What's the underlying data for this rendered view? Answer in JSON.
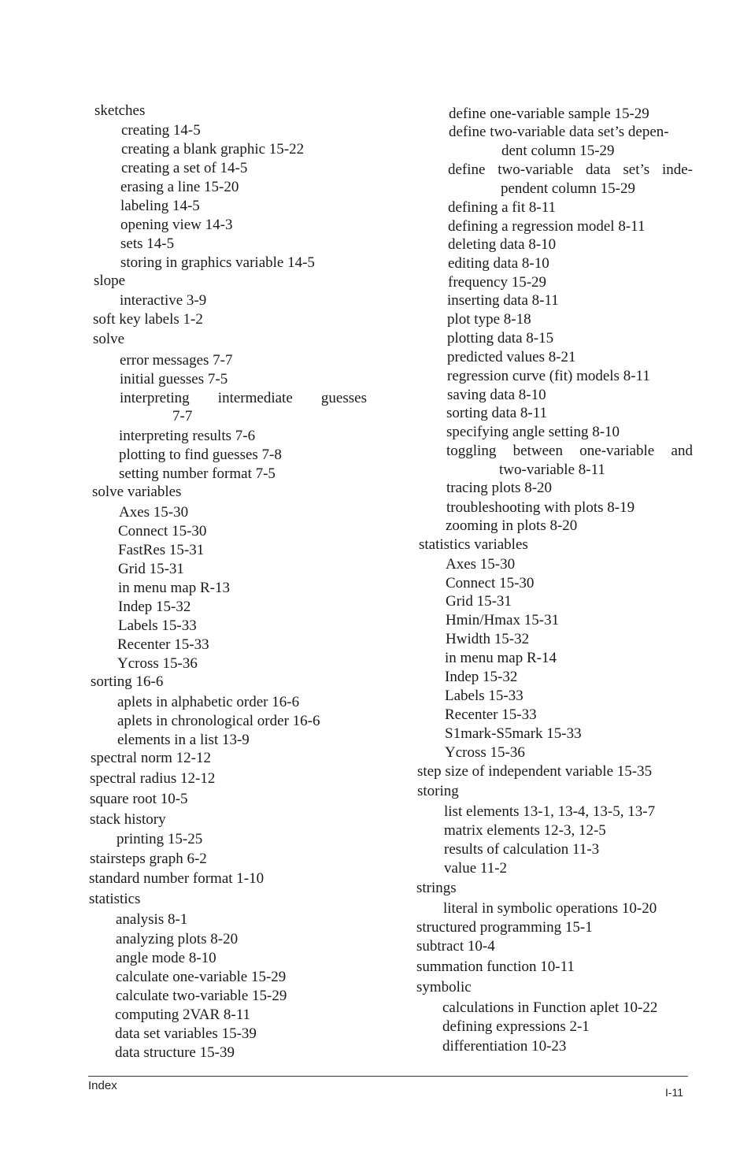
{
  "left_column": [
    {
      "text": "sketches",
      "level": 0
    },
    {
      "text": "creating 14-5",
      "level": 1
    },
    {
      "text": "creating a blank graphic 15-22",
      "level": 1
    },
    {
      "text": "creating a set of 14-5",
      "level": 1
    },
    {
      "text": "erasing a line 15-20",
      "level": 1
    },
    {
      "text": "labeling 14-5",
      "level": 1
    },
    {
      "text": "opening view 14-3",
      "level": 1
    },
    {
      "text": "sets 14-5",
      "level": 1
    },
    {
      "text": "storing in graphics variable 14-5",
      "level": 1
    },
    {
      "text": "slope",
      "level": 0
    },
    {
      "text": "interactive 3-9",
      "level": 1
    },
    {
      "text": "soft key labels 1-2",
      "level": 0
    },
    {
      "text": "solve",
      "level": 0
    },
    {
      "text": "error messages 7-7",
      "level": 1
    },
    {
      "text": "initial guesses 7-5",
      "level": 1
    },
    {
      "text": "interpreting intermediate guesses",
      "level": 1,
      "justify": true
    },
    {
      "text": "7-7",
      "level": 2
    },
    {
      "text": "interpreting results 7-6",
      "level": 1
    },
    {
      "text": "plotting to find guesses 7-8",
      "level": 1
    },
    {
      "text": "setting number format 7-5",
      "level": 1
    },
    {
      "text": "solve variables",
      "level": 0
    },
    {
      "text": "Axes 15-30",
      "level": 1
    },
    {
      "text": "Connect 15-30",
      "level": 1
    },
    {
      "text": "FastRes 15-31",
      "level": 1
    },
    {
      "text": "Grid 15-31",
      "level": 1
    },
    {
      "text": "in menu map R-13",
      "level": 1
    },
    {
      "text": "Indep 15-32",
      "level": 1
    },
    {
      "text": "Labels 15-33",
      "level": 1
    },
    {
      "text": "Recenter 15-33",
      "level": 1
    },
    {
      "text": "Ycross 15-36",
      "level": 1
    },
    {
      "text": "sorting 16-6",
      "level": 0
    },
    {
      "text": "aplets in alphabetic order 16-6",
      "level": 1
    },
    {
      "text": "aplets in chronological order 16-6",
      "level": 1
    },
    {
      "text": "elements in a list 13-9",
      "level": 1
    },
    {
      "text": "spectral norm 12-12",
      "level": 0
    },
    {
      "text": "spectral radius 12-12",
      "level": 0
    },
    {
      "text": "square root 10-5",
      "level": 0
    },
    {
      "text": "stack history",
      "level": 0
    },
    {
      "text": "printing 15-25",
      "level": 1
    },
    {
      "text": "stairsteps graph 6-2",
      "level": 0
    },
    {
      "text": "standard number format 1-10",
      "level": 0
    },
    {
      "text": "statistics",
      "level": 0
    },
    {
      "text": "analysis 8-1",
      "level": 1
    },
    {
      "text": "analyzing plots 8-20",
      "level": 1
    },
    {
      "text": "angle mode 8-10",
      "level": 1
    },
    {
      "text": "calculate one-variable 15-29",
      "level": 1
    },
    {
      "text": "calculate two-variable 15-29",
      "level": 1
    },
    {
      "text": "computing 2VAR 8-11",
      "level": 1
    },
    {
      "text": "data set variables 15-39",
      "level": 1
    },
    {
      "text": "data structure 15-39",
      "level": 1
    }
  ],
  "right_column": [
    {
      "text": "define one-variable sample 15-29",
      "level": 1
    },
    {
      "text": "define two-variable data set’s depen-",
      "level": 1
    },
    {
      "text": "dent column 15-29",
      "level": 2
    },
    {
      "text": "define two-variable data set’s inde-",
      "level": 1,
      "justify": true
    },
    {
      "text": "pendent column 15-29",
      "level": 2
    },
    {
      "text": "defining a fit 8-11",
      "level": 1
    },
    {
      "text": "defining a regression model 8-11",
      "level": 1
    },
    {
      "text": "deleting data 8-10",
      "level": 1
    },
    {
      "text": "editing data 8-10",
      "level": 1
    },
    {
      "text": "frequency 15-29",
      "level": 1
    },
    {
      "text": "inserting data 8-11",
      "level": 1
    },
    {
      "text": "plot type 8-18",
      "level": 1
    },
    {
      "text": "plotting data 8-15",
      "level": 1
    },
    {
      "text": "predicted values 8-21",
      "level": 1
    },
    {
      "text": "regression curve (fit) models 8-11",
      "level": 1
    },
    {
      "text": "saving data 8-10",
      "level": 1
    },
    {
      "text": "sorting data 8-11",
      "level": 1
    },
    {
      "text": "specifying angle setting 8-10",
      "level": 1
    },
    {
      "text": "toggling between one-variable and",
      "level": 1,
      "justify": true
    },
    {
      "text": "two-variable 8-11",
      "level": 2
    },
    {
      "text": "tracing plots 8-20",
      "level": 1
    },
    {
      "text": "troubleshooting with plots 8-19",
      "level": 1
    },
    {
      "text": "zooming in plots 8-20",
      "level": 1
    },
    {
      "text": "statistics variables",
      "level": 0
    },
    {
      "text": "Axes 15-30",
      "level": 1
    },
    {
      "text": "Connect 15-30",
      "level": 1
    },
    {
      "text": "Grid 15-31",
      "level": 1
    },
    {
      "text": "Hmin/Hmax 15-31",
      "level": 1
    },
    {
      "text": "Hwidth 15-32",
      "level": 1
    },
    {
      "text": "in menu map R-14",
      "level": 1
    },
    {
      "text": "Indep 15-32",
      "level": 1
    },
    {
      "text": "Labels 15-33",
      "level": 1
    },
    {
      "text": "Recenter 15-33",
      "level": 1
    },
    {
      "text": "S1mark-S5mark 15-33",
      "level": 1
    },
    {
      "text": "Ycross 15-36",
      "level": 1
    },
    {
      "text": "step size of independent variable 15-35",
      "level": 0
    },
    {
      "text": "storing",
      "level": 0
    },
    {
      "text": "list elements 13-1, 13-4, 13-5, 13-7",
      "level": 1
    },
    {
      "text": "matrix elements 12-3, 12-5",
      "level": 1
    },
    {
      "text": "results of calculation 11-3",
      "level": 1
    },
    {
      "text": "value 11-2",
      "level": 1
    },
    {
      "text": "strings",
      "level": 0
    },
    {
      "text": "literal in symbolic operations 10-20",
      "level": 1
    },
    {
      "text": "structured programming 15-1",
      "level": 0
    },
    {
      "text": "subtract 10-4",
      "level": 0
    },
    {
      "text": "summation function 10-11",
      "level": 0
    },
    {
      "text": "symbolic",
      "level": 0
    },
    {
      "text": "calculations in Function aplet 10-22",
      "level": 1
    },
    {
      "text": "defining expressions 2-1",
      "level": 1
    },
    {
      "text": "differentiation 10-23",
      "level": 1
    }
  ],
  "footer": {
    "section": "Index",
    "page": "I-11"
  }
}
